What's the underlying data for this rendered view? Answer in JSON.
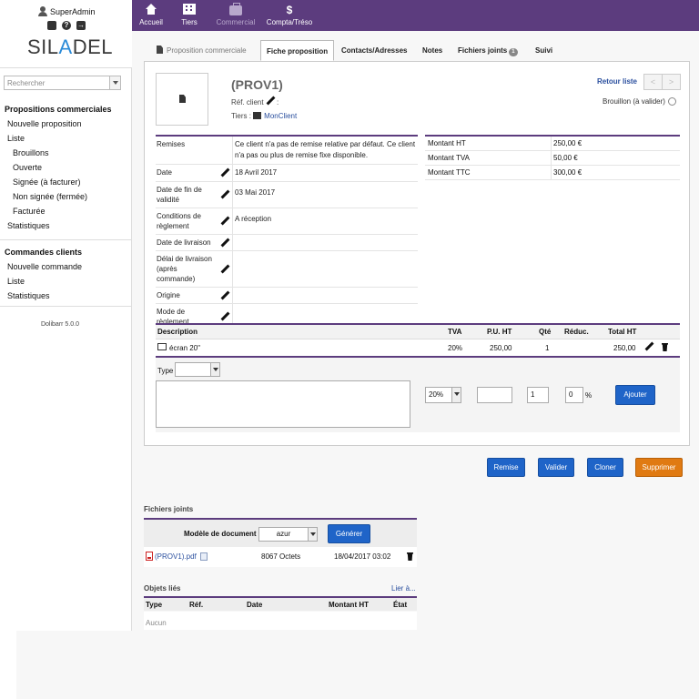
{
  "user": {
    "name": "SuperAdmin"
  },
  "logo": {
    "text_start": "SIL",
    "text_accent": "A",
    "text_end": "DEL"
  },
  "search": {
    "placeholder": "Rechercher"
  },
  "sidebar": {
    "proposals": {
      "title": "Propositions commerciales",
      "items": [
        "Nouvelle proposition",
        "Liste"
      ],
      "sub_items": [
        "Brouillons",
        "Ouverte",
        "Signée (à facturer)",
        "Non signée (fermée)",
        "Facturée"
      ],
      "stats": "Statistiques"
    },
    "orders": {
      "title": "Commandes clients",
      "items": [
        "Nouvelle commande",
        "Liste",
        "Statistiques"
      ]
    },
    "version": "Dolibarr 5.0.0"
  },
  "topnav": [
    {
      "label": "Accueil",
      "icon": "home-icon"
    },
    {
      "label": "Tiers",
      "icon": "building-icon"
    },
    {
      "label": "Commercial",
      "icon": "briefcase-icon"
    },
    {
      "label": "Compta/Tréso",
      "icon": "dollar-icon"
    }
  ],
  "tabs": {
    "t0": "Proposition commerciale",
    "t1": "Fiche proposition",
    "t2": "Contacts/Adresses",
    "t3": "Notes",
    "t4": "Fichiers joints",
    "t4_badge": "1",
    "t5": "Suivi"
  },
  "header": {
    "ref": "(PROV1)",
    "ref_client_label": "Réf. client",
    "ref_client_suffix": ":",
    "tiers_label": "Tiers :",
    "tiers_value": "MonClient",
    "back": "Retour liste",
    "prev": "<",
    "next": ">",
    "status": "Brouillon (à valider)"
  },
  "fields": {
    "remises_label": "Remises",
    "remises_value": "Ce client n'a pas de remise relative par défaut. Ce client n'a pas ou plus de remise fixe disponible.",
    "date_label": "Date",
    "date_value": "18 Avril 2017",
    "end_label": "Date de fin de validité",
    "end_value": "03 Mai 2017",
    "cond_label": "Conditions de règlement",
    "cond_value": "A réception",
    "delivery_label": "Date de livraison",
    "delivery_value": "",
    "delay_label": "Délai de livraison (après commande)",
    "delay_value": "",
    "origin_label": "Origine",
    "origin_value": "",
    "mode_label": "Mode de règlement",
    "mode_value": ""
  },
  "totals": {
    "ht_label": "Montant HT",
    "ht_value": "250,00 €",
    "tva_label": "Montant TVA",
    "tva_value": "50,00 €",
    "ttc_label": "Montant TTC",
    "ttc_value": "300,00 €"
  },
  "lines": {
    "headers": {
      "desc": "Description",
      "tva": "TVA",
      "pu": "P.U. HT",
      "qty": "Qté",
      "reduc": "Réduc.",
      "total": "Total HT"
    },
    "row": {
      "desc": "écran 20\"",
      "tva": "20%",
      "pu": "250,00",
      "qty": "1",
      "total": "250,00"
    },
    "add": {
      "type_label": "Type",
      "tva": "20%",
      "qty": "1",
      "reduc": "0",
      "pct": "%",
      "button": "Ajouter"
    }
  },
  "actions": {
    "remise": "Remise",
    "valider": "Valider",
    "cloner": "Cloner",
    "supprimer": "Supprimer"
  },
  "files": {
    "title": "Fichiers joints",
    "model_label": "Modèle de document",
    "model_value": "azur",
    "generate": "Générer",
    "file_name": "(PROV1).pdf",
    "file_size": "8067 Octets",
    "file_date": "18/04/2017 03:02"
  },
  "linked": {
    "title": "Objets liés",
    "link": "Lier à...",
    "headers": {
      "type": "Type",
      "ref": "Réf.",
      "date": "Date",
      "amount": "Montant HT",
      "state": "État"
    },
    "none": "Aucun"
  },
  "colors": {
    "topbar": "#5c3c7e",
    "button": "#1f64c8",
    "delete": "#e07a12",
    "link": "#2a4f9e"
  }
}
